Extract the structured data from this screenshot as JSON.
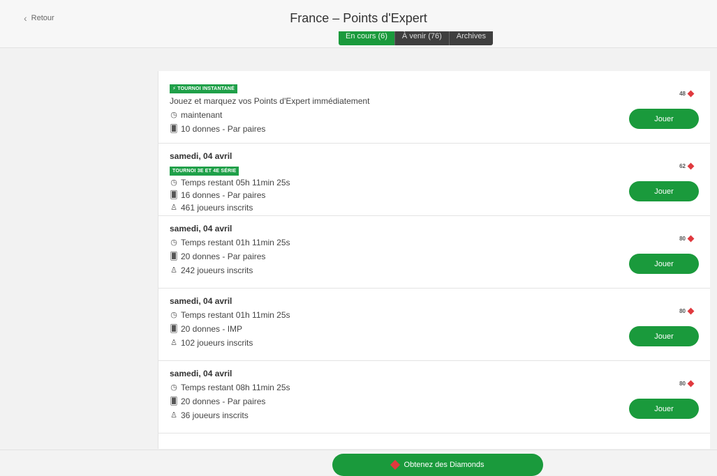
{
  "header": {
    "back_label": "Retour",
    "title": "France – Points d'Expert",
    "tabs": [
      {
        "label": "En cours (6)",
        "active": true
      },
      {
        "label": "À venir (76)",
        "active": false
      },
      {
        "label": "Archives",
        "active": false
      }
    ]
  },
  "tournaments": [
    {
      "date": "",
      "badge": "TOURNOI INSTANTANÉ",
      "description": "Jouez et marquez vos Points d'Expert immédiatement",
      "time": "maintenant",
      "deals": "10 donnes - Par paires",
      "players": "",
      "price": "48",
      "play_label": "Jouer"
    },
    {
      "date": "samedi, 04 avril",
      "badge": "TOURNOI 3E ET 4E SÉRIE",
      "description": "",
      "time": "Temps restant 05h 11min 25s",
      "deals": "16 donnes - Par paires",
      "players": "461 joueurs inscrits",
      "price": "62",
      "play_label": "Jouer"
    },
    {
      "date": "samedi, 04 avril",
      "badge": "",
      "description": "",
      "time": "Temps restant 01h 11min 25s",
      "deals": "20 donnes - Par paires",
      "players": "242 joueurs inscrits",
      "price": "80",
      "play_label": "Jouer"
    },
    {
      "date": "samedi, 04 avril",
      "badge": "",
      "description": "",
      "time": "Temps restant 01h 11min 25s",
      "deals": "20 donnes - IMP",
      "players": "102 joueurs inscrits",
      "price": "80",
      "play_label": "Jouer"
    },
    {
      "date": "samedi, 04 avril",
      "badge": "",
      "description": "",
      "time": "Temps restant 08h 11min 25s",
      "deals": "20 donnes - Par paires",
      "players": "36 joueurs inscrits",
      "price": "80",
      "play_label": "Jouer"
    }
  ],
  "footer": {
    "cta_label": "Obtenez des Diamonds"
  },
  "colors": {
    "accent_green": "#1a9a3c",
    "diamond_red": "#e0393e",
    "tab_dark": "#3f3f3f"
  },
  "icons": {
    "back": "chevron-left-icon",
    "time": "clock-icon",
    "deals": "cards-icon",
    "players": "users-icon",
    "price": "diamond-icon",
    "badge": "lightning-icon"
  }
}
